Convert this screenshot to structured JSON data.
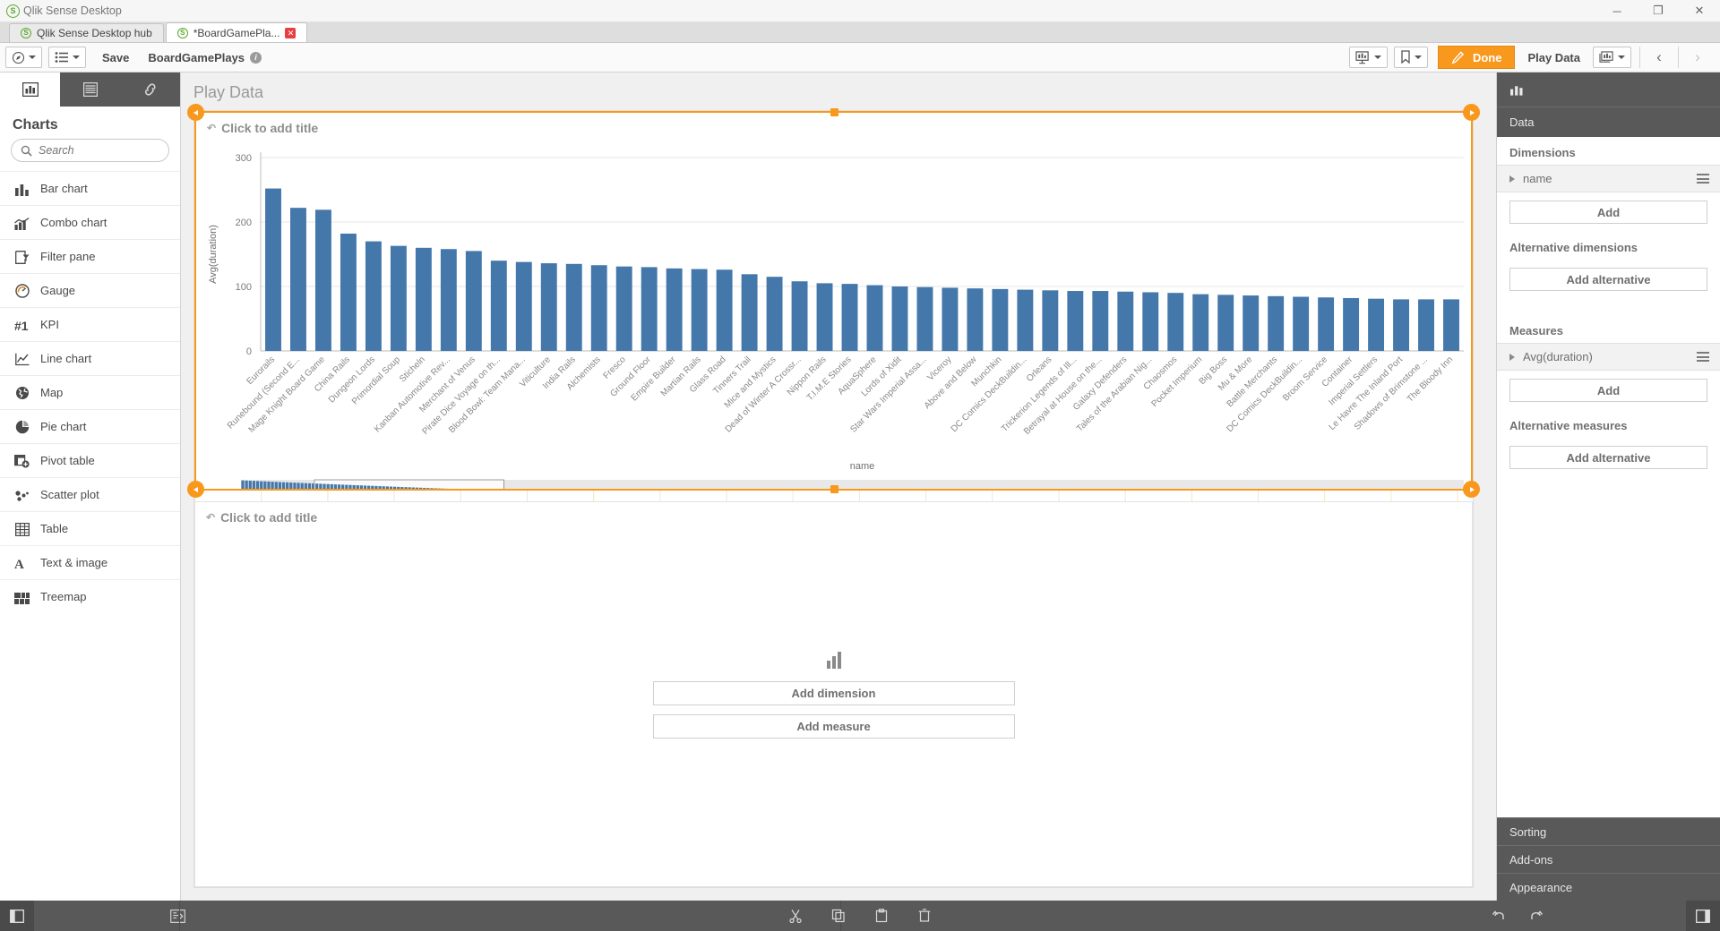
{
  "window": {
    "title": "Qlik Sense Desktop",
    "minimize": "─",
    "maximize": "❐",
    "close": "✕"
  },
  "tabs": [
    {
      "label": "Qlik Sense Desktop hub",
      "active": false,
      "closable": false
    },
    {
      "label": "*BoardGamePla...",
      "active": true,
      "closable": true,
      "close_glyph": "✕"
    }
  ],
  "toolbar": {
    "nav_icon": "compass-icon",
    "sheets_icon": "list-icon",
    "save_label": "Save",
    "app_name": "BoardGamePlays",
    "info_glyph": "i",
    "present_icon": "present-icon",
    "bookmark_icon": "bookmark-icon",
    "done_label": "Done",
    "edit_glyph": "✎",
    "sheet_name": "Play Data",
    "sheet_select_icon": "sheet-icon",
    "prev_glyph": "‹",
    "next_glyph": "›"
  },
  "left_panel": {
    "tabs": [
      {
        "name": "charts-tab",
        "icon": "bar-chart-icon",
        "active": true
      },
      {
        "name": "fields-tab",
        "icon": "table-icon",
        "active": false
      },
      {
        "name": "master-items-tab",
        "icon": "link-icon",
        "active": false
      }
    ],
    "heading": "Charts",
    "search_placeholder": "Search",
    "search_value": "",
    "items": [
      {
        "label": "Bar chart",
        "icon": "bar-chart-icon"
      },
      {
        "label": "Combo chart",
        "icon": "combo-chart-icon"
      },
      {
        "label": "Filter pane",
        "icon": "filter-pane-icon"
      },
      {
        "label": "Gauge",
        "icon": "gauge-icon"
      },
      {
        "label": "KPI",
        "icon": "kpi-icon"
      },
      {
        "label": "Line chart",
        "icon": "line-chart-icon"
      },
      {
        "label": "Map",
        "icon": "map-icon"
      },
      {
        "label": "Pie chart",
        "icon": "pie-chart-icon"
      },
      {
        "label": "Pivot table",
        "icon": "pivot-table-icon"
      },
      {
        "label": "Scatter plot",
        "icon": "scatter-plot-icon"
      },
      {
        "label": "Table",
        "icon": "table-icon"
      },
      {
        "label": "Text & image",
        "icon": "text-image-icon"
      },
      {
        "label": "Treemap",
        "icon": "treemap-icon"
      }
    ]
  },
  "sheet": {
    "title": "Play Data",
    "object1": {
      "title_placeholder": "Click to add title",
      "selected": true
    },
    "object2": {
      "title_placeholder": "Click to add title",
      "add_dimension_label": "Add dimension",
      "add_measure_label": "Add measure",
      "icon": "bar-chart-icon"
    }
  },
  "right_panel": {
    "header_icon": "bar-chart-icon",
    "data_section": "Data",
    "dimensions_label": "Dimensions",
    "dimension_items": [
      {
        "label": "name"
      }
    ],
    "dimensions_add": "Add",
    "alt_dimensions_label": "Alternative dimensions",
    "alt_dimensions_add": "Add alternative",
    "measures_label": "Measures",
    "measure_items": [
      {
        "label": "Avg(duration)"
      }
    ],
    "measures_add": "Add",
    "alt_measures_label": "Alternative measures",
    "alt_measures_add": "Add alternative",
    "collapsed_sections": [
      "Sorting",
      "Add-ons",
      "Appearance"
    ]
  },
  "bottom_bar": {
    "left_icon": "panel-toggle-icon",
    "sheet_icon": "insight-icon",
    "center_icons": [
      "cut-icon",
      "copy-icon",
      "paste-icon",
      "delete-icon"
    ],
    "undo_icon": "undo-icon",
    "redo_icon": "redo-icon",
    "right_icon": "panel-toggle-icon"
  },
  "colors": {
    "accent": "#f8981d",
    "bar": "#4477aa",
    "panel_dark": "#595959",
    "grid": "#fae3c8"
  },
  "chart_data": {
    "type": "bar",
    "title": "",
    "xlabel": "name",
    "ylabel": "Avg(duration)",
    "ylim": [
      0,
      300
    ],
    "yticks": [
      0,
      100,
      200,
      300
    ],
    "grid": true,
    "legend": "none",
    "orientation": "vertical",
    "bar_color": "#4477aa",
    "categories": [
      "Eurorails",
      "Runebound (Second E...",
      "Mage Knight Board Game",
      "China Rails",
      "Dungeon Lords",
      "Primordial Soup",
      "Sticheln",
      "Kanban Automotive Rev...",
      "Merchant of Venus",
      "Pirate Dice Voyage on th...",
      "Blood Bowl: Team Mana...",
      "Viticulture",
      "India Rails",
      "Alchemists",
      "Fresco",
      "Ground Floor",
      "Empire Builder",
      "Martian Rails",
      "Glass Road",
      "Tinners Trail",
      "Mice and Mystics",
      "Dead of Winter A Crossr...",
      "Nippon Rails",
      "T.I.M.E Stories",
      "AquaSphere",
      "Lords of Xidit",
      "Star Wars Imperial Assa...",
      "Viceroy",
      "Above and Below",
      "Munchkin",
      "DC Comics DeckBuildin...",
      "Orleans",
      "Trickerion Legends of Ill...",
      "Betrayal at House on the...",
      "Galaxy Defenders",
      "Tales of the Arabian Nig...",
      "Chaosmos",
      "Pocket Imperium",
      "Big Boss",
      "Mu & More",
      "Battle Merchants",
      "DC Comics DeckBuildin...",
      "Broom Service",
      "Container",
      "Imperial Settlers",
      "Le Havre The Inland Port",
      "Shadows of Brimstone ...",
      "The Bloody Inn"
    ],
    "values": [
      252,
      222,
      219,
      182,
      170,
      163,
      160,
      158,
      155,
      140,
      138,
      136,
      135,
      133,
      131,
      130,
      128,
      127,
      126,
      119,
      115,
      108,
      105,
      104,
      102,
      100,
      99,
      98,
      97,
      96,
      95,
      94,
      93,
      93,
      92,
      91,
      90,
      88,
      87,
      86,
      85,
      84,
      83,
      82,
      81,
      80,
      80,
      80
    ],
    "scrollbar": {
      "visible": true,
      "window_start_fraction": 0.06,
      "window_end_fraction": 0.215,
      "total_points": 330
    }
  }
}
